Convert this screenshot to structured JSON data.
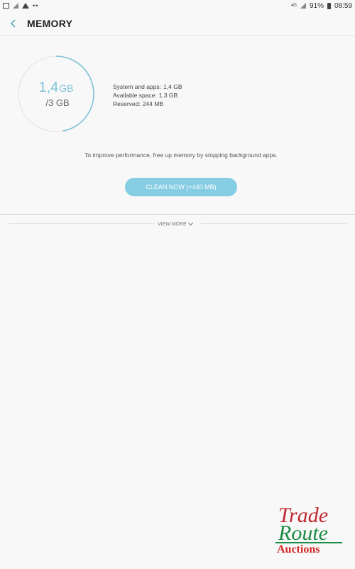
{
  "status_bar": {
    "battery": "91%",
    "time": "08:59",
    "network": "4G"
  },
  "header": {
    "title": "MEMORY"
  },
  "memory": {
    "used_value": "1,4",
    "used_unit": "GB",
    "total": "/3 GB",
    "used_fraction": 0.47,
    "details": [
      {
        "label": "System and apps:",
        "value": "1,4 GB"
      },
      {
        "label": "Available space:",
        "value": "1,3 GB"
      },
      {
        "label": "Reserved:",
        "value": "244 MB"
      }
    ]
  },
  "hint": "To improve performance, free up memory by stopping background apps.",
  "clean_button": "CLEAN NOW (+440 MB)",
  "view_more": "VIEW MORE",
  "watermark": {
    "line1": "Trade",
    "line2": "Route",
    "line3": "Auctions"
  },
  "colors": {
    "accent": "#85cde3",
    "ring_used": "#7fc2d8",
    "ring_track": "#e6e6e6"
  }
}
